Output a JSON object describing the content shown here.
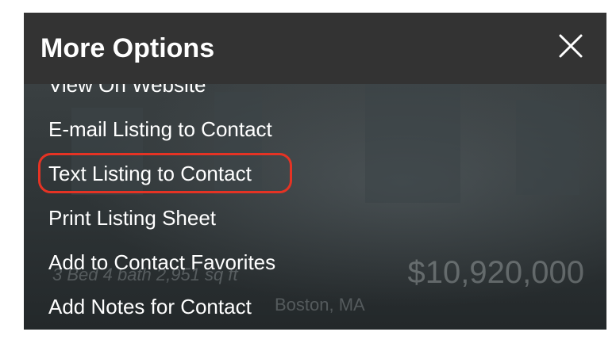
{
  "dialog": {
    "title": "More Options",
    "close_icon": "close-icon"
  },
  "menu": {
    "items": [
      {
        "label": "View On Website"
      },
      {
        "label": "E-mail Listing to Contact"
      },
      {
        "label": "Text Listing to Contact",
        "highlighted": true
      },
      {
        "label": "Print Listing Sheet"
      },
      {
        "label": "Add to Contact Favorites"
      },
      {
        "label": "Add Notes for Contact"
      }
    ]
  },
  "background_listing": {
    "details": "3 Bed  4 bath  2,951 sq ft",
    "price": "$10,920,000",
    "address": "Boston, MA"
  },
  "colors": {
    "header": "#333333",
    "highlight_ring": "#e53324",
    "text": "#ffffff"
  }
}
